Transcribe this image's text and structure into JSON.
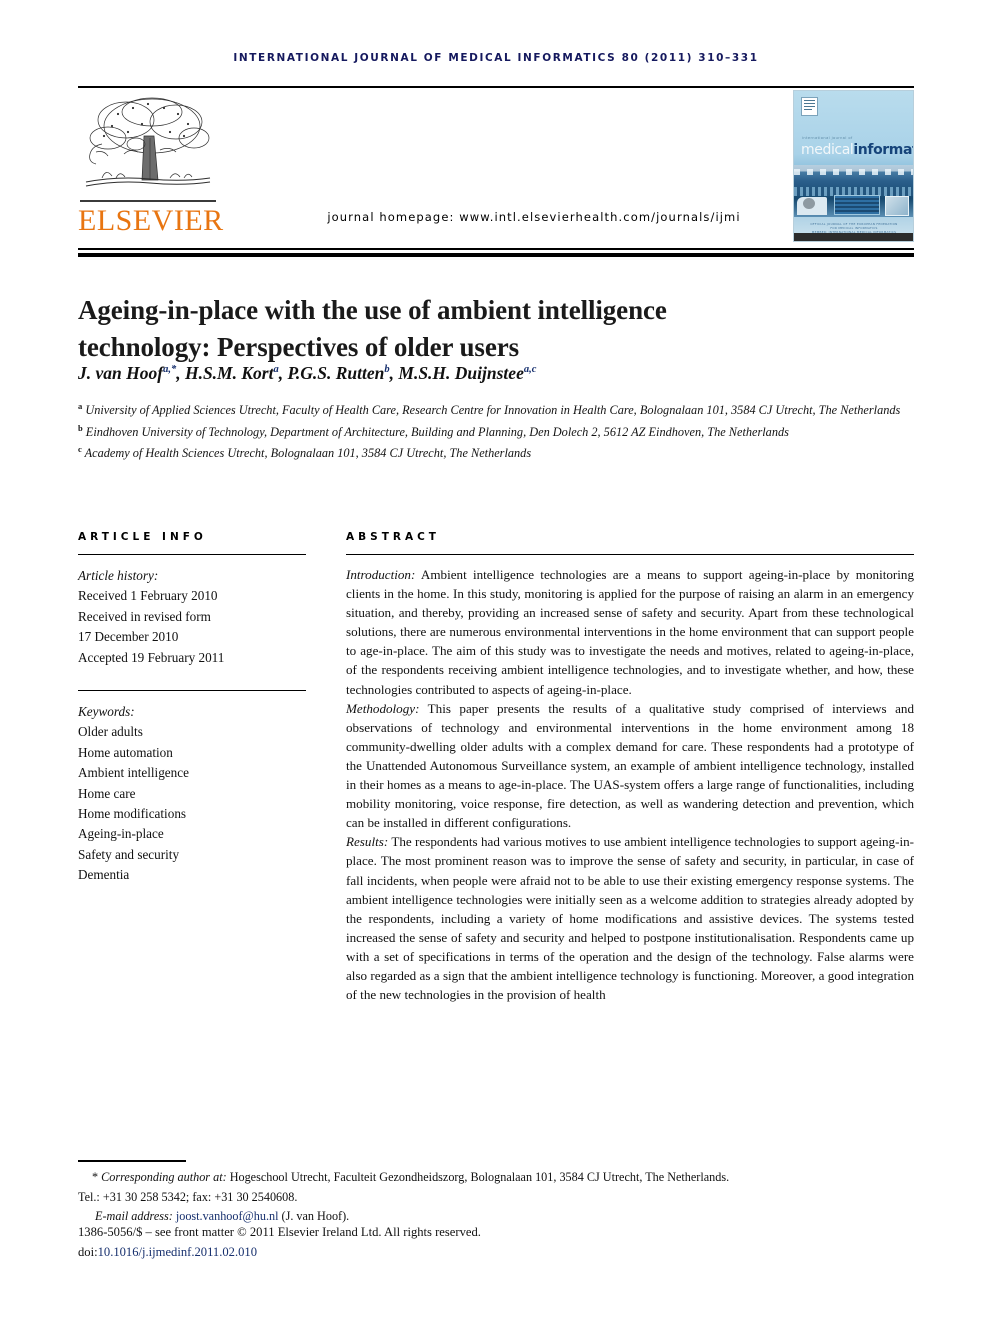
{
  "journal": {
    "running_head": "INTERNATIONAL JOURNAL OF MEDICAL INFORMATICS 80 (2011) 310–331",
    "homepage": "journal homepage: www.intl.elsevierhealth.com/journals/ijmi",
    "publisher_name": "ELSEVIER",
    "publisher_logo_alt": "elsevier-tree-logo",
    "cover": {
      "supertitle": "international journal of",
      "title_part_1": "medical",
      "title_part_2": "informatics",
      "caption_line_1": "OFFICIAL JOURNAL OF THE EUROPEAN FEDERATION FOR MEDICAL INFORMATICS",
      "caption_line_2": "MEMBER: INTERNATIONAL MEDICAL INFORMATICS ASSOCIATION"
    }
  },
  "article": {
    "title": "Ageing-in-place with the use of ambient intelligence technology: Perspectives of older users",
    "authors": [
      {
        "name": "J. van Hoof",
        "marks": "a,*"
      },
      {
        "name": "H.S.M. Kort",
        "marks": "a"
      },
      {
        "name": "P.G.S. Rutten",
        "marks": "b"
      },
      {
        "name": "M.S.H. Duijnstee",
        "marks": "a,c"
      }
    ],
    "affiliations": [
      {
        "mark": "a",
        "text": "University of Applied Sciences Utrecht, Faculty of Health Care, Research Centre for Innovation in Health Care, Bolognalaan 101, 3584 CJ Utrecht, The Netherlands"
      },
      {
        "mark": "b",
        "text": "Eindhoven University of Technology, Department of Architecture, Building and Planning, Den Dolech 2, 5612 AZ Eindhoven, The Netherlands"
      },
      {
        "mark": "c",
        "text": "Academy of Health Sciences Utrecht, Bolognalaan 101, 3584 CJ Utrecht, The Netherlands"
      }
    ]
  },
  "article_info": {
    "section_heading": "ARTICLE INFO",
    "history_label": "Article history:",
    "history": [
      "Received 1 February 2010",
      "Received in revised form",
      "17 December 2010",
      "Accepted 19 February 2011"
    ],
    "keywords_label": "Keywords:",
    "keywords": [
      "Older adults",
      "Home automation",
      "Ambient intelligence",
      "Home care",
      "Home modifications",
      "Ageing-in-place",
      "Safety and security",
      "Dementia"
    ]
  },
  "abstract": {
    "section_heading": "ABSTRACT",
    "paragraphs": [
      {
        "lead": "Introduction:",
        "text": " Ambient intelligence technologies are a means to support ageing-in-place by monitoring clients in the home. In this study, monitoring is applied for the purpose of raising an alarm in an emergency situation, and thereby, providing an increased sense of safety and security. Apart from these technological solutions, there are numerous environmental interventions in the home environment that can support people to age-in-place. The aim of this study was to investigate the needs and motives, related to ageing-in-place, of the respondents receiving ambient intelligence technologies, and to investigate whether, and how, these technologies contributed to aspects of ageing-in-place."
      },
      {
        "lead": "Methodology:",
        "text": " This paper presents the results of a qualitative study comprised of interviews and observations of technology and environmental interventions in the home environment among 18 community-dwelling older adults with a complex demand for care. These respondents had a prototype of the Unattended Autonomous Surveillance system, an example of ambient intelligence technology, installed in their homes as a means to age-in-place. The UAS-system offers a large range of functionalities, including mobility monitoring, voice response, fire detection, as well as wandering detection and prevention, which can be installed in different configurations."
      },
      {
        "lead": "Results:",
        "text": " The respondents had various motives to use ambient intelligence technologies to support ageing-in-place. The most prominent reason was to improve the sense of safety and security, in particular, in case of fall incidents, when people were afraid not to be able to use their existing emergency response systems. The ambient intelligence technologies were initially seen as a welcome addition to strategies already adopted by the respondents, including a variety of home modifications and assistive devices. The systems tested increased the sense of safety and security and helped to postpone institutionalisation. Respondents came up with a set of specifications in terms of the operation and the design of the technology. False alarms were also regarded as a sign that the ambient intelligence technology is functioning. Moreover, a good integration of the new technologies in the provision of health"
      }
    ]
  },
  "footnotes": {
    "corresponding_marker": "*",
    "corresponding_label": "Corresponding author at:",
    "corresponding_address": " Hogeschool Utrecht, Faculteit Gezondheidszorg, Bolognalaan 101, 3584 CJ Utrecht, The Netherlands.",
    "tel_fax": "Tel.: +31 30 258 5342; fax: +31 30 2540608.",
    "email_label": "E-mail address:",
    "email": "joost.vanhoof@hu.nl",
    "email_owner": "(J. van Hoof).",
    "issn_line": "1386-5056/$ – see front matter © 2011 Elsevier Ireland Ltd. All rights reserved.",
    "doi_label": "doi:",
    "doi": "10.1016/j.ijmedinf.2011.02.010"
  },
  "colors": {
    "running_head": "#15195e",
    "elsevier_orange": "#e87511",
    "link": "#17306e"
  }
}
